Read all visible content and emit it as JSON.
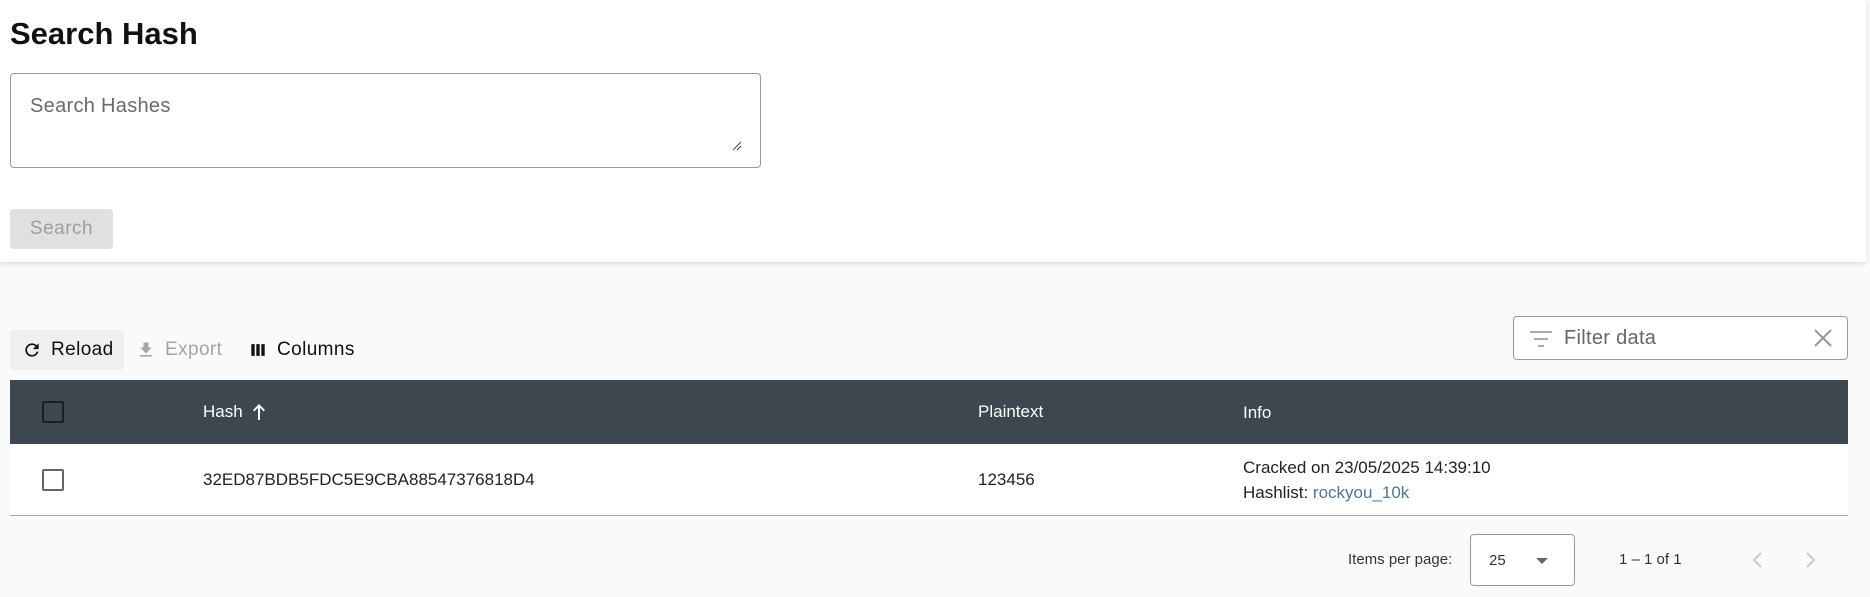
{
  "header": {
    "title": "Search Hash"
  },
  "search": {
    "placeholder": "Search Hashes",
    "value": "",
    "button_label": "Search"
  },
  "toolbar": {
    "reload_label": "Reload",
    "export_label": "Export",
    "columns_label": "Columns"
  },
  "filter": {
    "placeholder": "Filter data",
    "value": ""
  },
  "table": {
    "columns": [
      "Hash",
      "Plaintext",
      "Info"
    ],
    "sort": {
      "column": "Hash",
      "direction": "ascending"
    },
    "rows": [
      {
        "hash": "32ED87BDB5FDC5E9CBA88547376818D4",
        "plaintext": "123456",
        "info_cracked": "Cracked on 23/05/2025 14:39:10",
        "info_hashlist_label": "Hashlist:",
        "info_hashlist_link": "rockyou_10k",
        "selected": false
      }
    ]
  },
  "paginator": {
    "items_per_page_label": "Items per page:",
    "items_per_page": "25",
    "range_label": "1 – 1 of 1"
  },
  "colors": {
    "header_bg": "#3d4750",
    "link": "#4a7a93",
    "disabled_button_bg": "#e0e0e0"
  },
  "icons": {
    "reload": "refresh-icon",
    "export": "download-icon",
    "columns": "view-column-icon",
    "filter": "filter-list-icon",
    "clear": "close-icon",
    "sort": "arrow-upward-icon",
    "prev": "chevron-left-icon",
    "next": "chevron-right-icon"
  }
}
